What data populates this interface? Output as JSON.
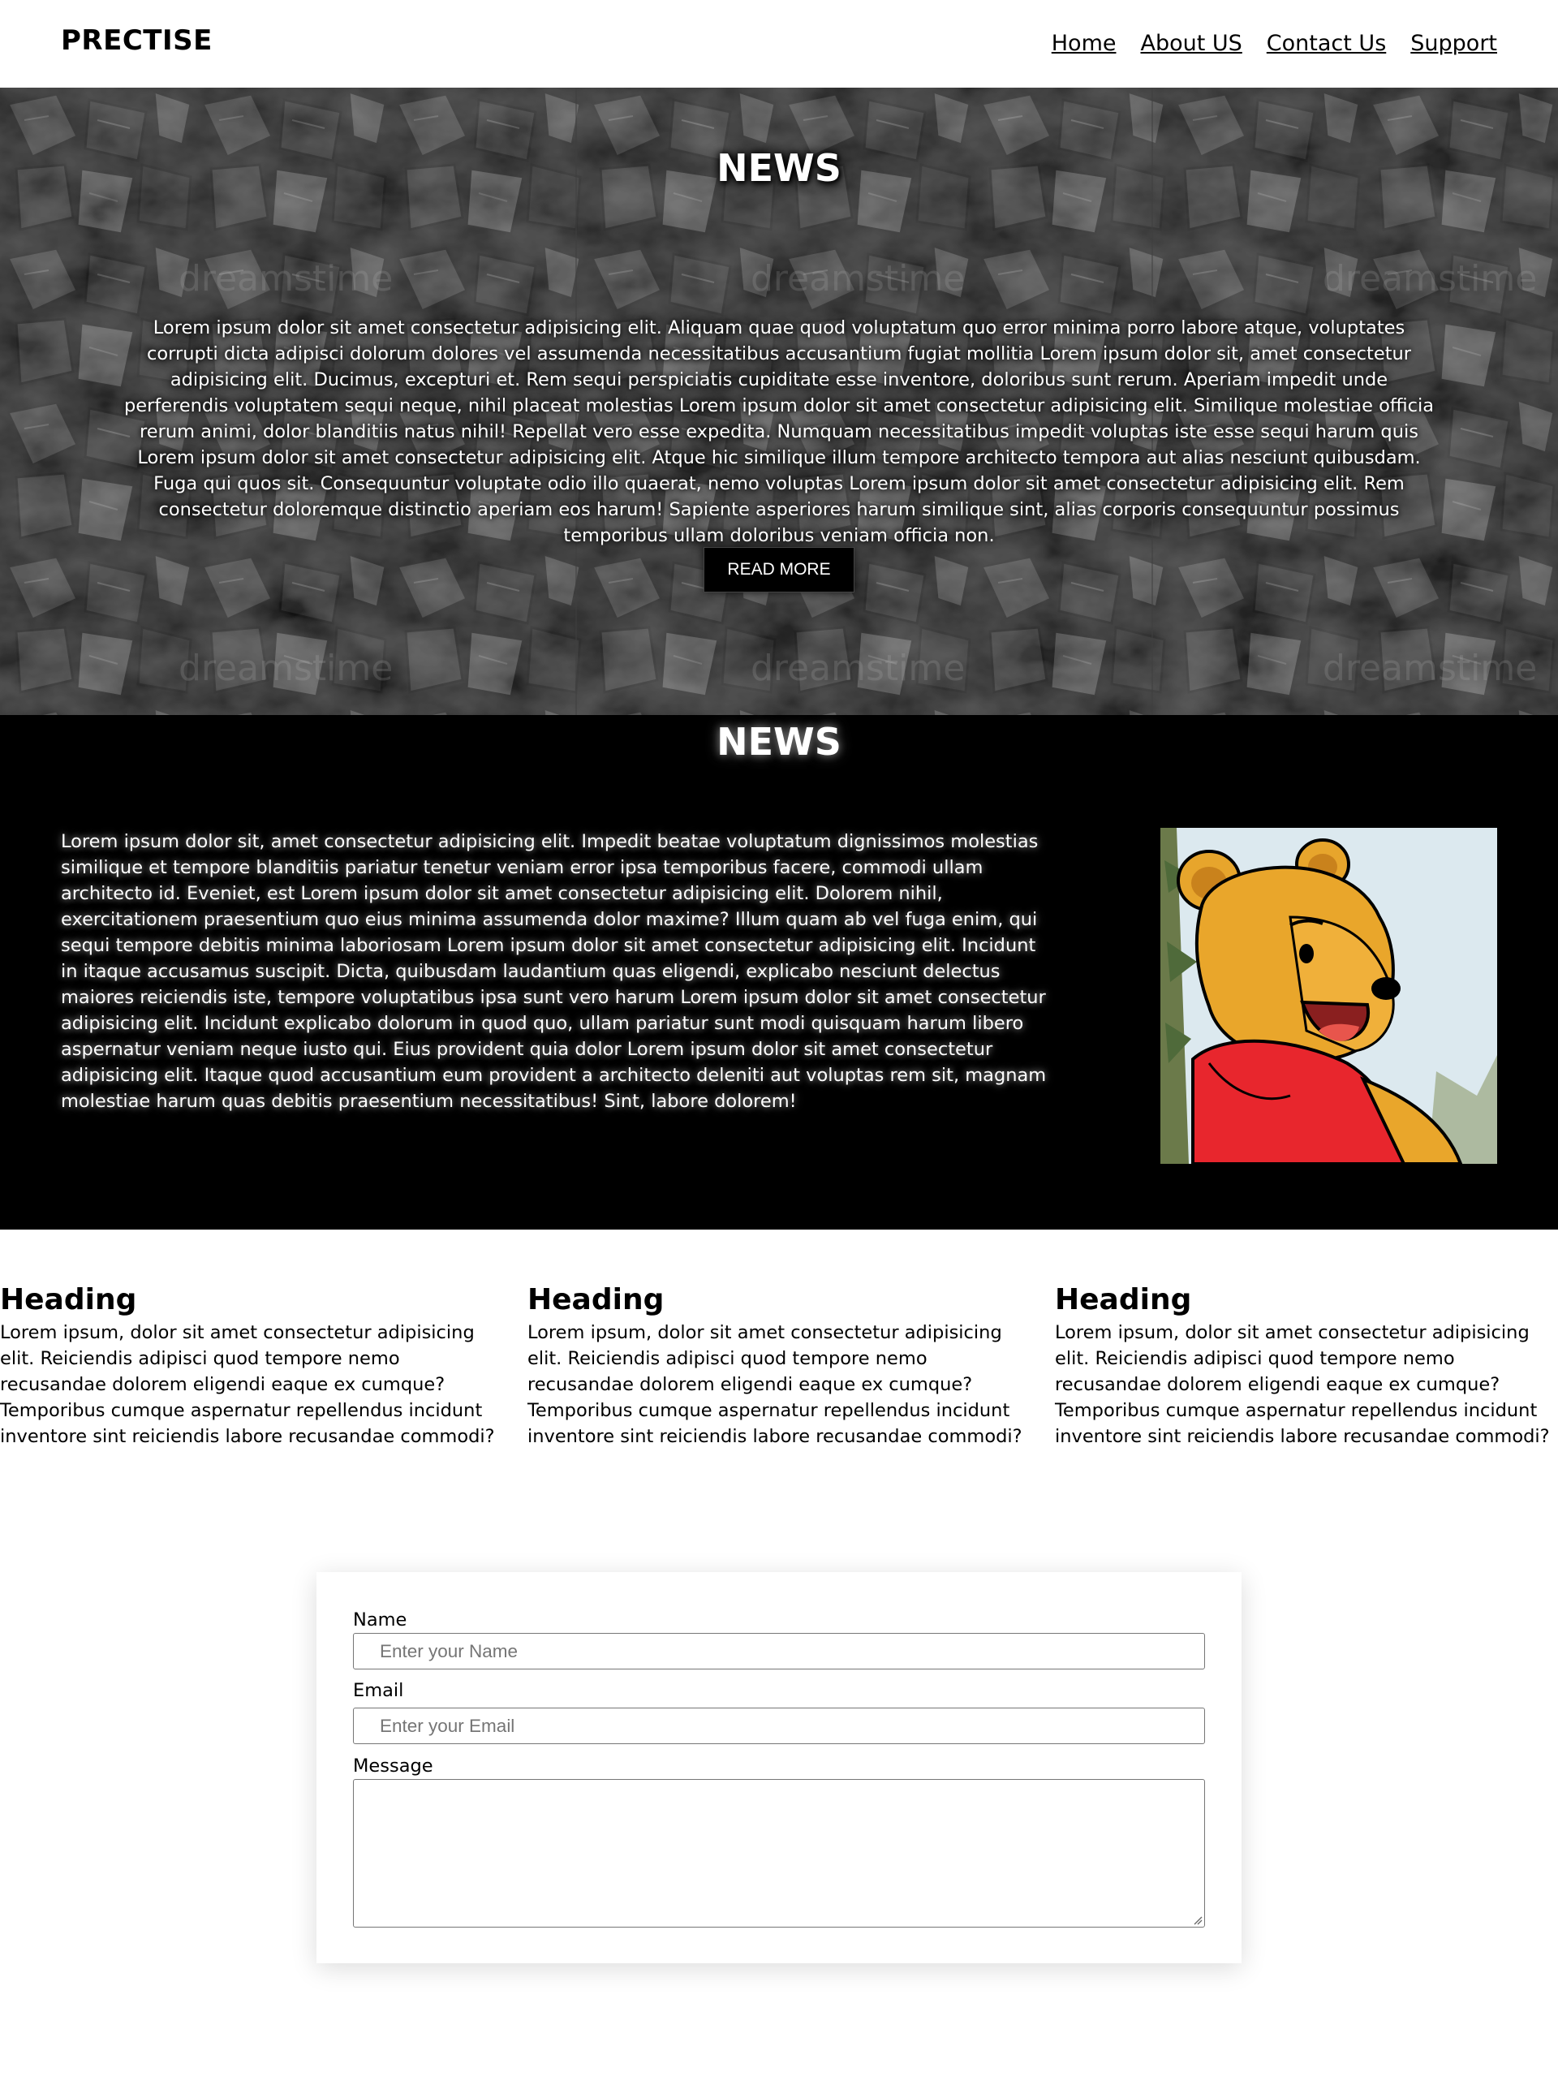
{
  "header": {
    "brand": "PRECTISE",
    "nav": [
      "Home",
      "About US",
      "Contact Us",
      "Support"
    ]
  },
  "hero": {
    "title": "NEWS",
    "text": "Lorem ipsum dolor sit amet consectetur adipisicing elit. Aliquam quae quod voluptatum quo error minima porro labore atque, voluptates corrupti dicta adipisci dolorum dolores vel assumenda necessitatibus accusantium fugiat mollitia Lorem ipsum dolor sit, amet consectetur adipisicing elit. Ducimus, excepturi et. Rem sequi perspiciatis cupiditate esse inventore, doloribus sunt rerum. Aperiam impedit unde perferendis voluptatem sequi neque, nihil placeat molestias Lorem ipsum dolor sit amet consectetur adipisicing elit. Similique molestiae officia rerum animi, dolor blanditiis natus nihil! Repellat vero esse expedita. Numquam necessitatibus impedit voluptas iste esse sequi harum quis Lorem ipsum dolor sit amet consectetur adipisicing elit. Atque hic similique illum tempore architecto tempora aut alias nesciunt quibusdam. Fuga qui quos sit. Consequuntur voluptate odio illo quaerat, nemo voluptas Lorem ipsum dolor sit amet consectetur adipisicing elit. Rem consectetur doloremque distinctio aperiam eos harum! Sapiente asperiores harum similique sint, alias corporis consequuntur possimus temporibus ullam doloribus veniam officia non.",
    "button": "READ MORE",
    "watermark": "dreamstime"
  },
  "news2": {
    "title": "NEWS",
    "text": "Lorem ipsum dolor sit, amet consectetur adipisicing elit. Impedit beatae voluptatum dignissimos molestias similique et tempore blanditiis pariatur tenetur veniam error ipsa temporibus facere, commodi ullam architecto id. Eveniet, est Lorem ipsum dolor sit amet consectetur adipisicing elit. Dolorem nihil, exercitationem praesentium quo eius minima assumenda dolor maxime? Illum quam ab vel fuga enim, qui sequi tempore debitis minima laboriosam Lorem ipsum dolor sit amet consectetur adipisicing elit. Incidunt in itaque accusamus suscipit. Dicta, quibusdam laudantium quas eligendi, explicabo nesciunt delectus maiores reiciendis iste, tempore voluptatibus ipsa sunt vero harum Lorem ipsum dolor sit amet consectetur adipisicing elit. Incidunt explicabo dolorum in quod quo, ullam pariatur sunt modi quisquam harum libero aspernatur veniam neque iusto qui. Eius provident quia dolor Lorem ipsum dolor sit amet consectetur adipisicing elit. Itaque quod accusantium eum provident a architecto deleniti aut voluptas rem sit, magnam molestiae harum quas debitis praesentium necessitatibus! Sint, labore dolorem!"
  },
  "columns": [
    {
      "heading": "Heading",
      "text": "Lorem ipsum, dolor sit amet consectetur adipisicing elit. Reiciendis adipisci quod tempore nemo recusandae dolorem eligendi eaque ex cumque? Temporibus cumque aspernatur repellendus incidunt inventore sint reiciendis labore recusandae commodi?"
    },
    {
      "heading": "Heading",
      "text": "Lorem ipsum, dolor sit amet consectetur adipisicing elit. Reiciendis adipisci quod tempore nemo recusandae dolorem eligendi eaque ex cumque? Temporibus cumque aspernatur repellendus incidunt inventore sint reiciendis labore recusandae commodi?"
    },
    {
      "heading": "Heading",
      "text": "Lorem ipsum, dolor sit amet consectetur adipisicing elit. Reiciendis adipisci quod tempore nemo recusandae dolorem eligendi eaque ex cumque? Temporibus cumque aspernatur repellendus incidunt inventore sint reiciendis labore recusandae commodi?"
    }
  ],
  "form": {
    "name_label": "Name",
    "name_placeholder": "Enter your Name",
    "email_label": "Email",
    "email_placeholder": "Enter your Email",
    "message_label": "Message"
  }
}
